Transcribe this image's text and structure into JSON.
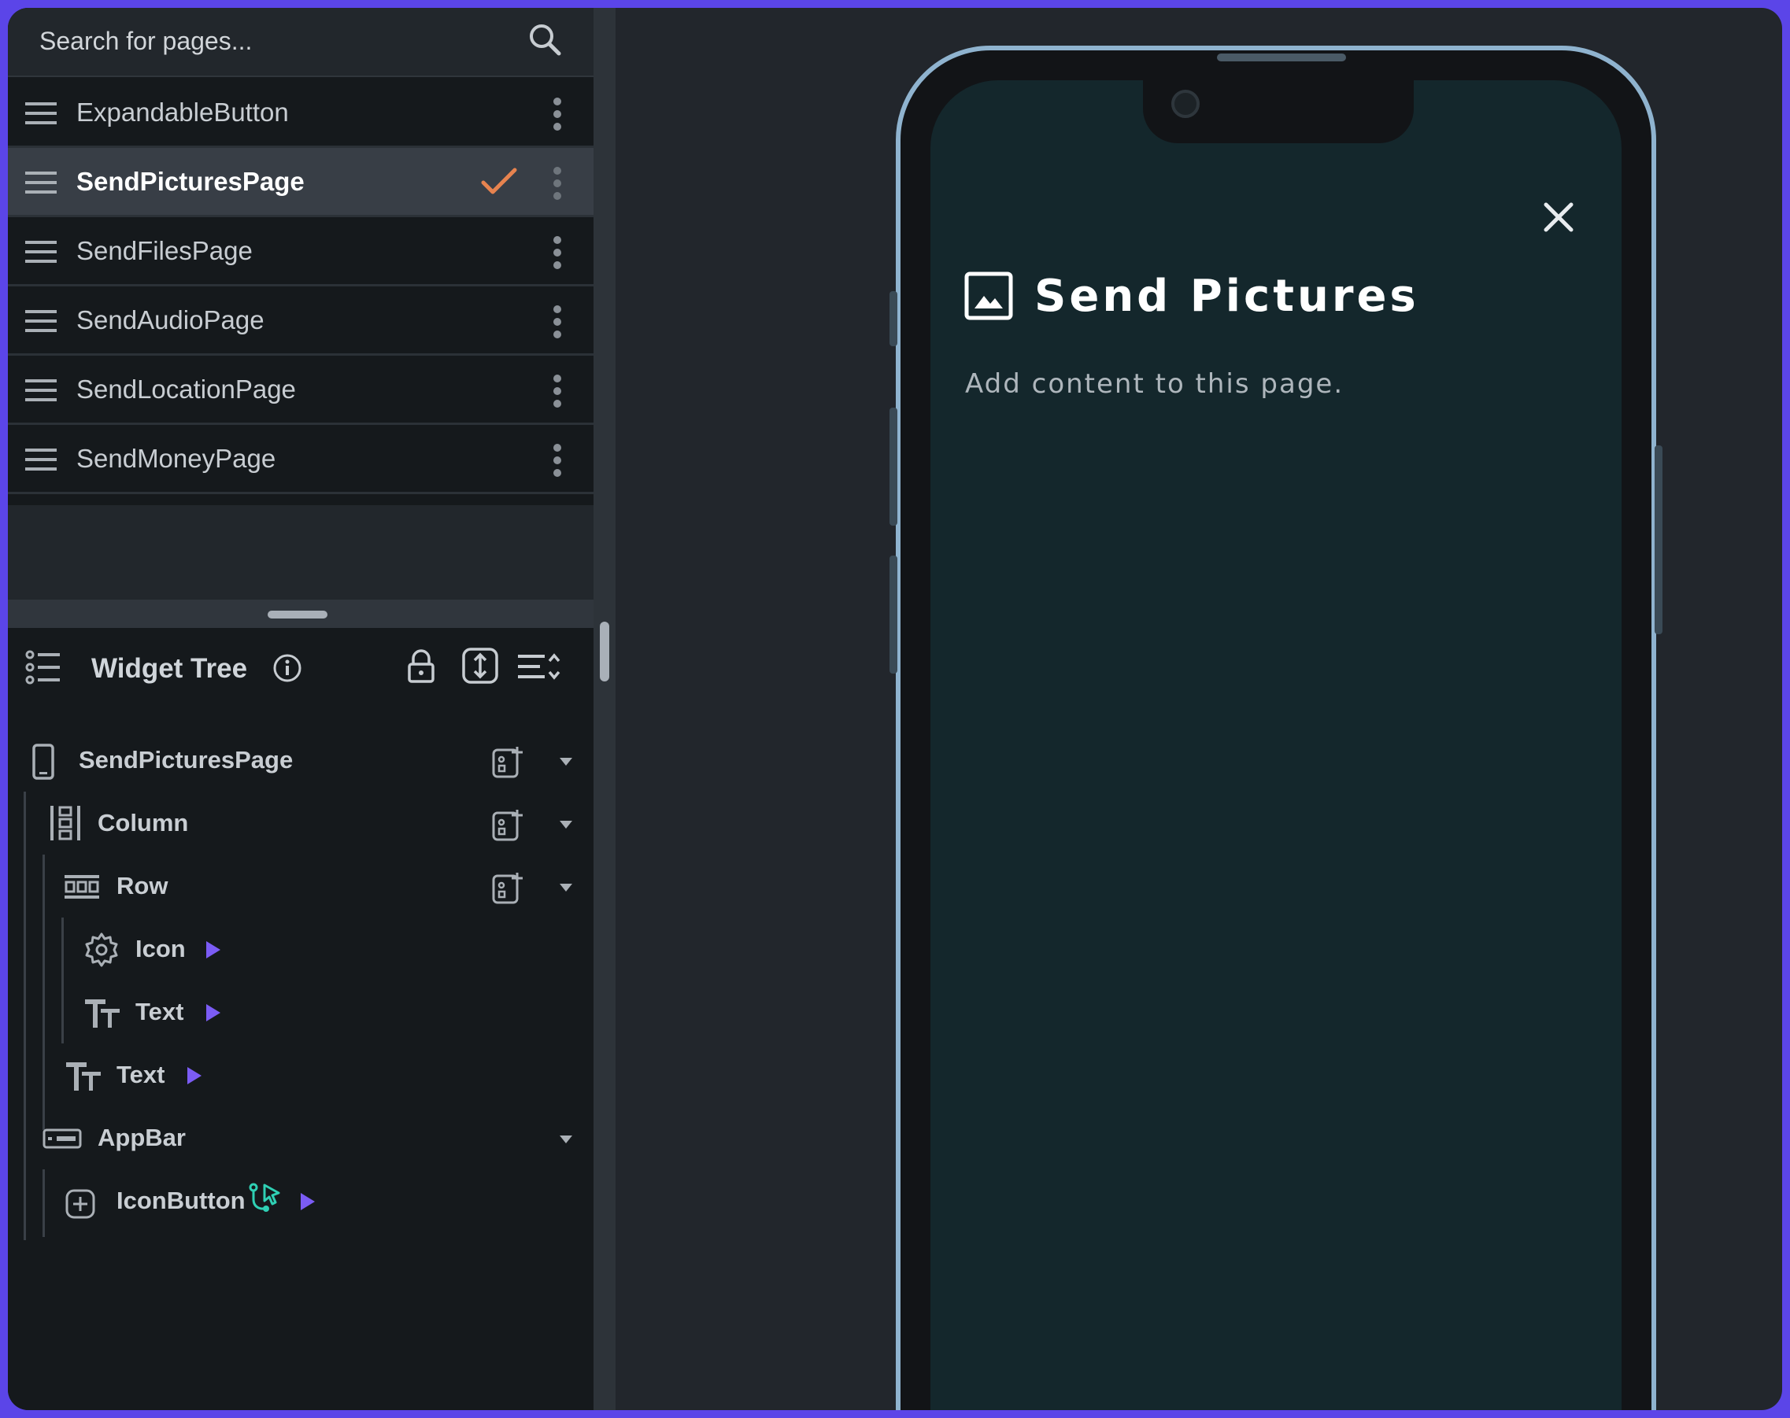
{
  "search": {
    "placeholder": "Search for pages..."
  },
  "pages": [
    {
      "label": "ExpandableButton",
      "active": false
    },
    {
      "label": "SendPicturesPage",
      "active": true
    },
    {
      "label": "SendFilesPage",
      "active": false
    },
    {
      "label": "SendAudioPage",
      "active": false
    },
    {
      "label": "SendLocationPage",
      "active": false
    },
    {
      "label": "SendMoneyPage",
      "active": false
    }
  ],
  "widget_tree": {
    "title": "Widget Tree",
    "nodes": [
      {
        "label": "SendPicturesPage",
        "icon": "phone-icon"
      },
      {
        "label": "Column",
        "icon": "column-icon"
      },
      {
        "label": "Row",
        "icon": "row-icon"
      },
      {
        "label": "Icon",
        "icon": "gear-icon"
      },
      {
        "label": "Text",
        "icon": "text-icon"
      },
      {
        "label": "Text",
        "icon": "text-icon"
      },
      {
        "label": "AppBar",
        "icon": "appbar-icon"
      },
      {
        "label": "IconButton",
        "icon": "plus-box-icon"
      }
    ]
  },
  "preview": {
    "title": "Send Pictures",
    "body": "Add content to this page."
  },
  "colors": {
    "accent": "#5b45e8",
    "check": "#e7834f",
    "action": "#2fd0b4",
    "arrow": "#7b5cf5",
    "phone_border": "#8fb3cf"
  }
}
